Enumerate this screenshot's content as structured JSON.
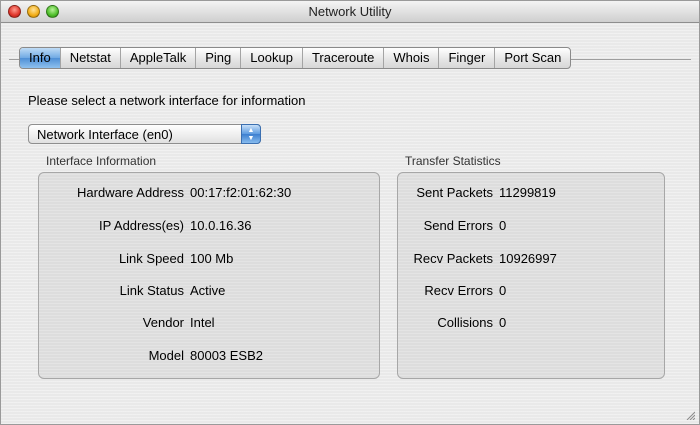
{
  "window": {
    "title": "Network Utility"
  },
  "tabs": [
    "Info",
    "Netstat",
    "AppleTalk",
    "Ping",
    "Lookup",
    "Traceroute",
    "Whois",
    "Finger",
    "Port Scan"
  ],
  "active_tab": "Info",
  "prompt": "Please select a network interface for information",
  "interface_select": {
    "selected": "Network Interface (en0)"
  },
  "interface_info": {
    "title": "Interface Information",
    "rows": [
      {
        "label": "Hardware Address",
        "value": "00:17:f2:01:62:30"
      },
      {
        "label": "IP Address(es)",
        "value": "10.0.16.36"
      },
      {
        "label": "Link Speed",
        "value": "100 Mb"
      },
      {
        "label": "Link Status",
        "value": "Active"
      },
      {
        "label": "Vendor",
        "value": "Intel"
      },
      {
        "label": "Model",
        "value": "80003 ESB2"
      }
    ]
  },
  "transfer_stats": {
    "title": "Transfer Statistics",
    "rows": [
      {
        "label": "Sent Packets",
        "value": "11299819"
      },
      {
        "label": "Send Errors",
        "value": "0"
      },
      {
        "label": "Recv Packets",
        "value": "10926997"
      },
      {
        "label": "Recv Errors",
        "value": "0"
      },
      {
        "label": "Collisions",
        "value": "0"
      }
    ]
  },
  "colors": {
    "active_tab": "#5b9be0",
    "window_bg": "#e9e9e9"
  }
}
